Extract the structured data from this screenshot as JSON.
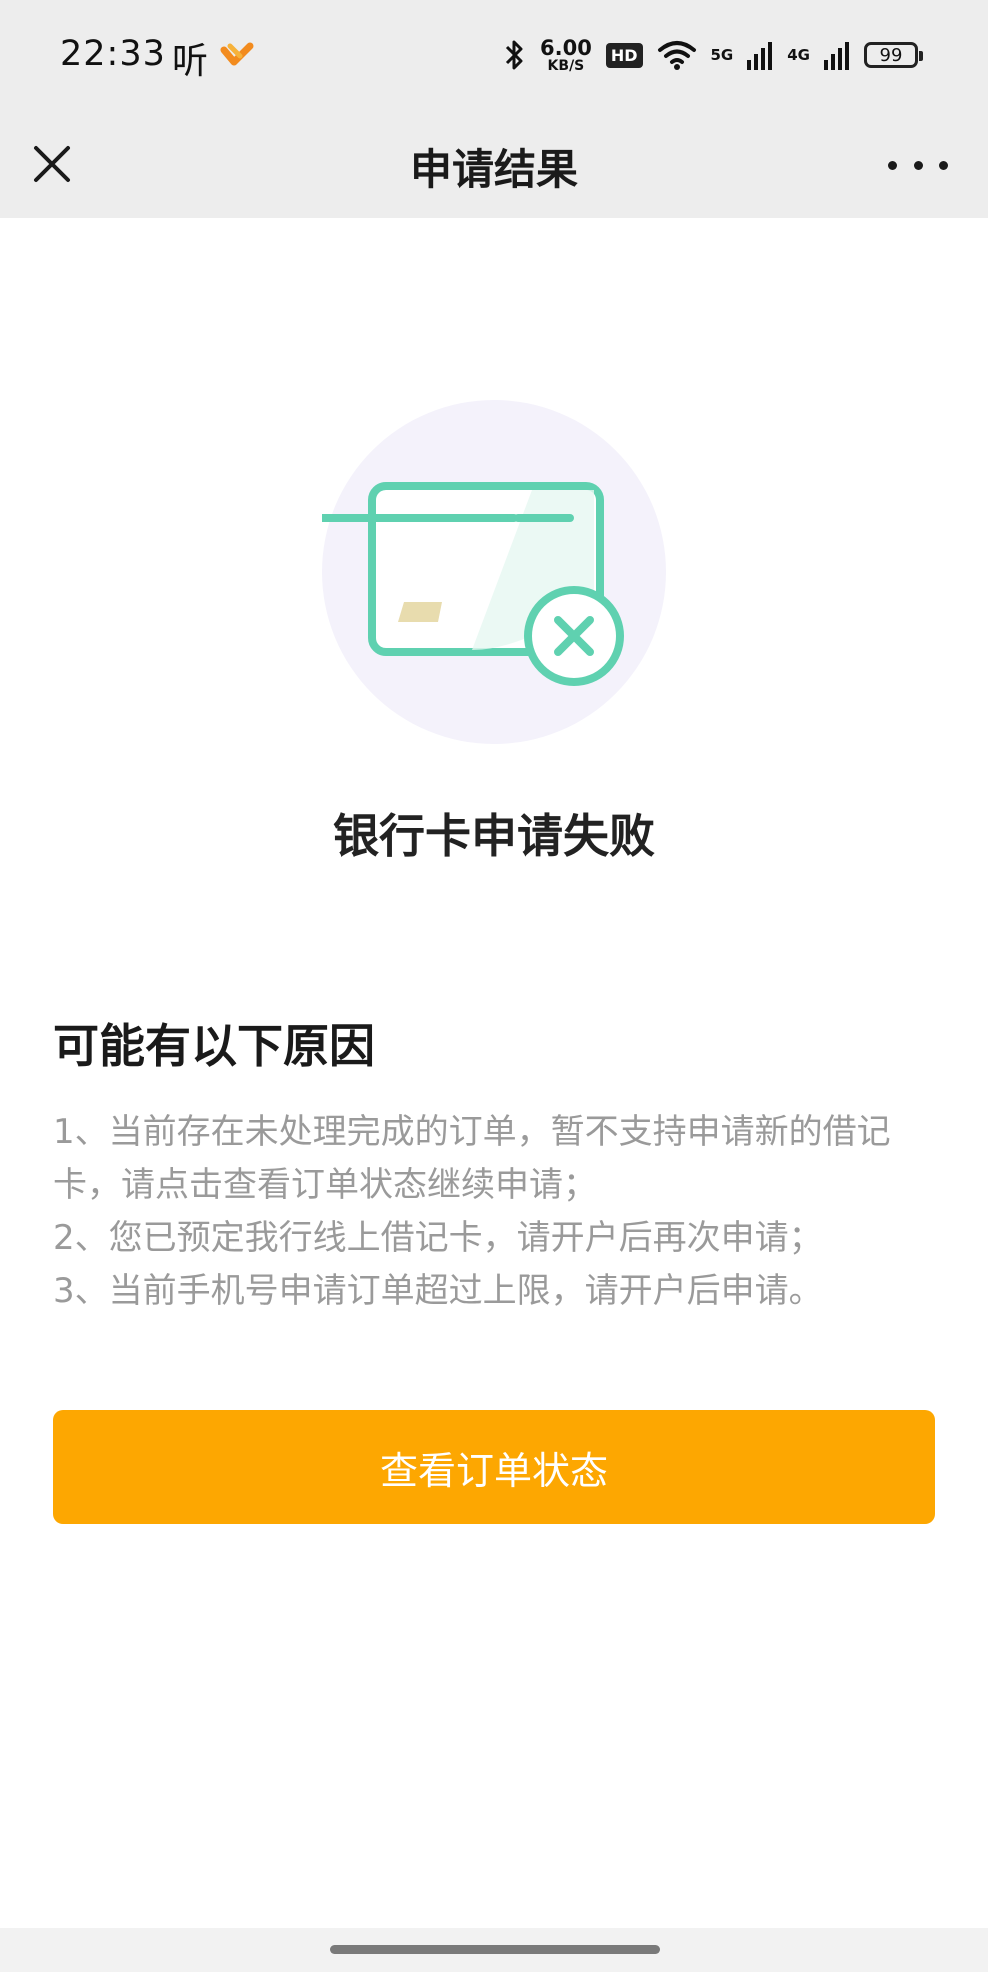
{
  "status_bar": {
    "time": "22:33",
    "app_char": "听",
    "speed_value": "6.00",
    "speed_unit": "KB/S",
    "hd_label": "HD",
    "net_5g": "5G",
    "net_4g": "4G",
    "battery": "99"
  },
  "header": {
    "title": "申请结果"
  },
  "result": {
    "title": "银行卡申请失败",
    "illustration_colors": {
      "circle": "#f4f2fb",
      "card": "#5fd1b0",
      "chip": "#e8dcae"
    }
  },
  "reasons": {
    "title": "可能有以下原因",
    "items": [
      "1、当前存在未处理完成的订单，暂不支持申请新的借记卡，请点击查看订单状态继续申请；",
      "2、您已预定我行线上借记卡，请开户后再次申请；",
      "3、当前手机号申请订单超过上限，请开户后申请。"
    ]
  },
  "actions": {
    "view_order_status": "查看订单状态",
    "button_color": "#fda701"
  }
}
